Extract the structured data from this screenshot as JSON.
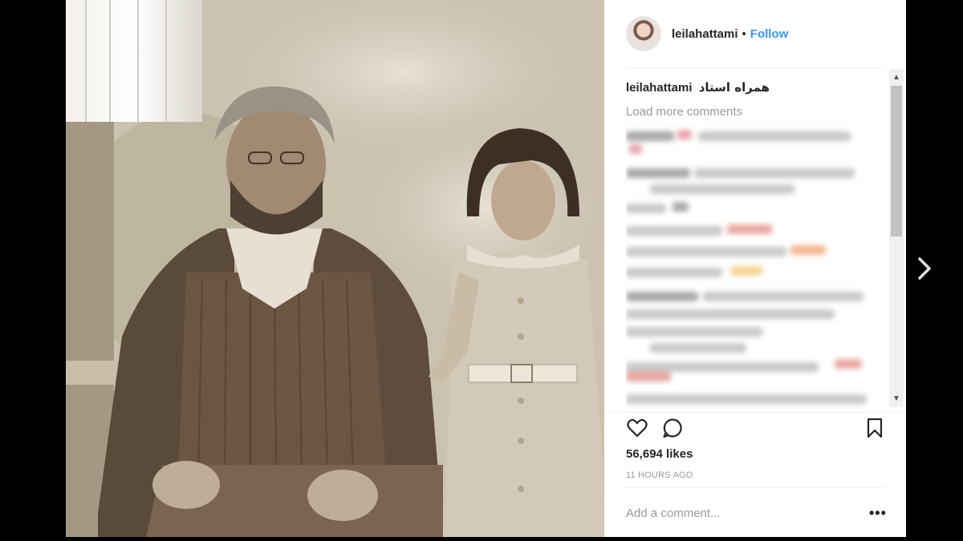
{
  "post": {
    "username": "leilahattami",
    "separator": "•",
    "follow_label": "Follow",
    "caption_user": "leilahattami",
    "caption_text": "همراه استاد",
    "load_more_label": "Load more comments",
    "likes_text": "56,694 likes",
    "time_text": "11 HOURS AGO",
    "add_comment_placeholder": "Add a comment...",
    "more_options_label": "•••"
  },
  "icons": {
    "like": "heart-outline-icon",
    "comment": "speech-bubble-icon",
    "save": "bookmark-icon",
    "next": "chevron-right-icon",
    "scroll_up": "triangle-up-icon",
    "scroll_down": "triangle-down-icon"
  },
  "colors": {
    "follow": "#3897f0",
    "text": "#262626",
    "muted": "#999999",
    "backdrop": "#000000"
  }
}
